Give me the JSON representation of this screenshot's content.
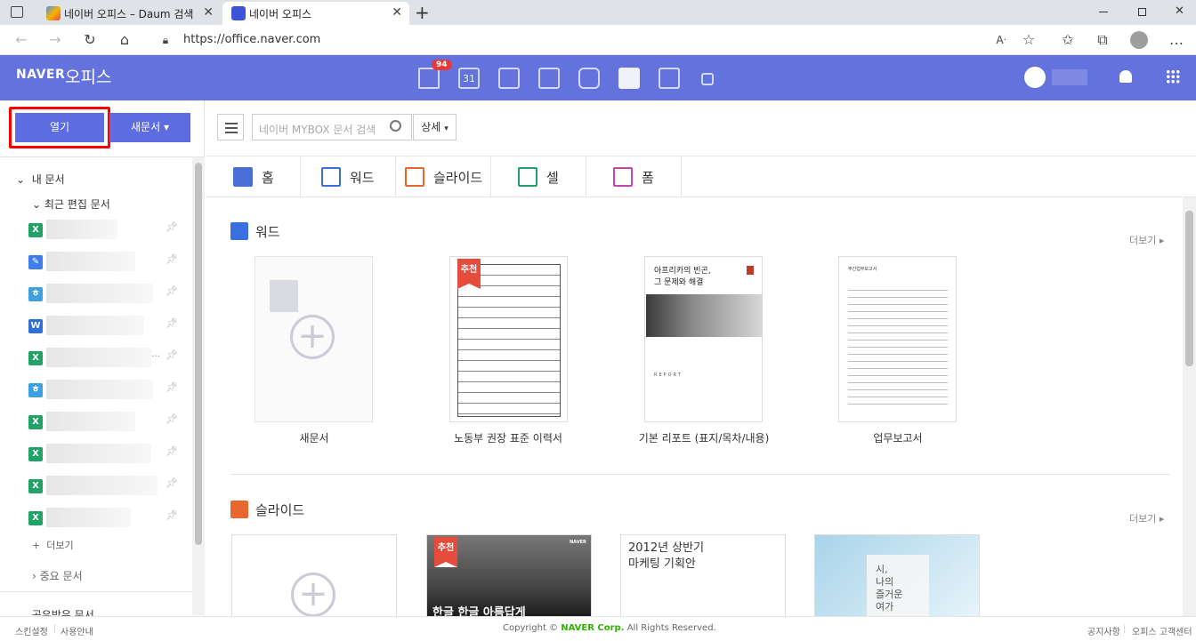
{
  "browser": {
    "tabs": [
      {
        "title": "네이버 오피스 – Daum 검색"
      },
      {
        "title": "네이버 오피스"
      }
    ],
    "url": "https://office.naver.com",
    "new_tab": "+",
    "close": "✕"
  },
  "header": {
    "logo_brand": "NAVER",
    "logo_product": "오피스",
    "mail_badge": "94",
    "calendar_day": "31",
    "app_icons": [
      "mail-icon",
      "calendar-icon",
      "list-icon",
      "contacts-icon",
      "box-icon",
      "form-icon",
      "home-icon",
      "memo-icon"
    ]
  },
  "left": {
    "open_label": "열기",
    "new_doc_label": "새문서",
    "my_docs": "내 문서",
    "recent": "최근 편집 문서",
    "more": "더보기",
    "important": "중요 문서",
    "shared": "공유받은 문서",
    "files": [
      {
        "type": "X",
        "color": "#21a366",
        "w": 80
      },
      {
        "type": "✎",
        "color": "#3d7ee8",
        "w": 100
      },
      {
        "type": "ㅎ",
        "color": "#3fa0e0",
        "w": 120
      },
      {
        "type": "W",
        "color": "#2f6fd8",
        "w": 110
      },
      {
        "type": "X",
        "color": "#21a366",
        "w": 118,
        "ellipsis": "…"
      },
      {
        "type": "ㅎ",
        "color": "#3fa0e0",
        "w": 120
      },
      {
        "type": "X",
        "color": "#21a366",
        "w": 100
      },
      {
        "type": "X",
        "color": "#21a366",
        "w": 118
      },
      {
        "type": "X",
        "color": "#21a366",
        "w": 125
      },
      {
        "type": "X",
        "color": "#21a366",
        "w": 95
      }
    ]
  },
  "toolbar": {
    "search_placeholder": "네이버 MYBOX 문서 검색",
    "detail_label": "상세"
  },
  "main_tabs": [
    {
      "label": "홈",
      "color": "#4a6fd8"
    },
    {
      "label": "워드",
      "color": "#3a6fe0"
    },
    {
      "label": "슬라이드",
      "color": "#e8672c"
    },
    {
      "label": "셀",
      "color": "#22a06b"
    },
    {
      "label": "폼",
      "color": "#c447b0"
    }
  ],
  "word_section": {
    "title": "워드",
    "more": "더보기",
    "templates": [
      {
        "caption": "새문서"
      },
      {
        "caption": "노동부 권장 표준 이력서",
        "badge": "추천"
      },
      {
        "caption": "기본 리포트 (표지/목차/내용)",
        "doc_title": "아프리카의 빈곤,\n그 문제와 해결",
        "doc_footer": "REPORT"
      },
      {
        "caption": "업무보고서",
        "doc_title": "주간업무보고서"
      }
    ]
  },
  "slide_section": {
    "title": "슬라이드",
    "more": "더보기",
    "templates": [
      {
        "caption": ""
      },
      {
        "badge": "추천",
        "text": "한글 한글 아름답게",
        "logo": "NAVER"
      },
      {
        "text": "2012년 상반기\n마케팅 기획안"
      },
      {
        "text": "시,\n나의\n즐거운\n여가"
      }
    ]
  },
  "footer": {
    "skin": "스킨설정",
    "guide": "사용안내",
    "copyright_prefix": "Copyright ©",
    "copyright_brand": "NAVER Corp.",
    "copyright_suffix": "All Rights Reserved.",
    "notice": "공지사항",
    "support": "오피스 고객센터"
  },
  "colors": {
    "header": "#6472de",
    "primary_button": "#5b6de0",
    "highlight": "#ff0000"
  }
}
